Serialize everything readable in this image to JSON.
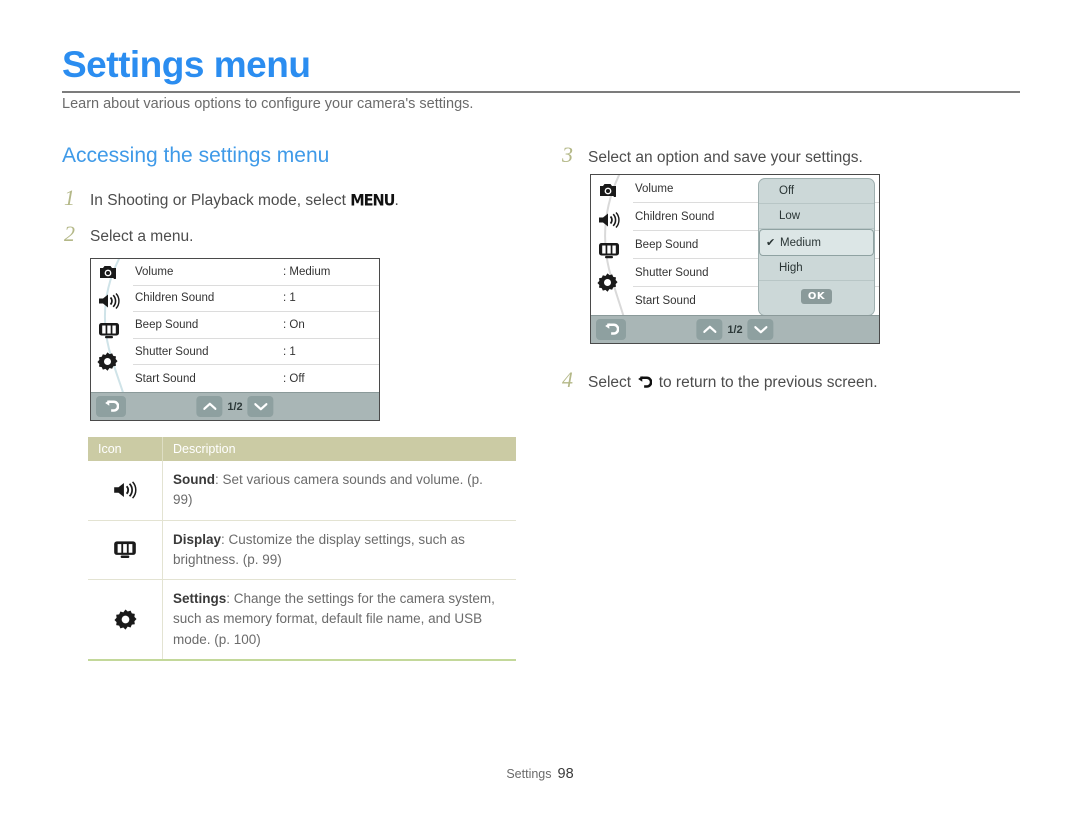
{
  "header": {
    "title": "Settings menu",
    "subtitle": "Learn about various options to configure your camera's settings.",
    "section_heading": "Accessing the settings menu",
    "title_color": "#2b8df0",
    "heading_color": "#3f9ae8"
  },
  "steps": [
    {
      "num": "1",
      "text_before": "In Shooting or Playback mode, select ",
      "glyph": "MENU",
      "text_after": "."
    },
    {
      "num": "2",
      "text_before": "Select a menu.",
      "glyph": "",
      "text_after": ""
    },
    {
      "num": "3",
      "text_before": "Select an option and save your settings.",
      "glyph": "",
      "text_after": ""
    },
    {
      "num": "4",
      "text_before": "Select ",
      "glyph": "back-arrow-icon",
      "text_after": " to return to the previous screen."
    }
  ],
  "step_number_color": "#b4b888",
  "screen1": {
    "rail_icons": [
      "camera-icon",
      "sound-icon",
      "display-icon",
      "settings-gear-icon"
    ],
    "rows": [
      {
        "label": "Volume",
        "value": ": Medium"
      },
      {
        "label": "Children Sound",
        "value": ": 1"
      },
      {
        "label": "Beep Sound",
        "value": ": On"
      },
      {
        "label": "Shutter Sound",
        "value": ": 1"
      },
      {
        "label": "Start Sound",
        "value": ": Off"
      }
    ],
    "toolbar": {
      "back": "back-arrow-icon",
      "up": "chevron-up-icon",
      "page": "1/2",
      "down": "chevron-down-icon"
    }
  },
  "screen2": {
    "rail_icons": [
      "camera-icon",
      "sound-icon",
      "display-icon",
      "settings-gear-icon"
    ],
    "rows": [
      {
        "label": "Volume"
      },
      {
        "label": "Children Sound"
      },
      {
        "label": "Beep Sound"
      },
      {
        "label": "Shutter Sound"
      },
      {
        "label": "Start Sound"
      }
    ],
    "dropdown": {
      "options": [
        {
          "label": "Off",
          "selected": false
        },
        {
          "label": "Low",
          "selected": false
        },
        {
          "label": "Medium",
          "selected": true
        },
        {
          "label": "High",
          "selected": false
        }
      ],
      "check_glyph": "✔",
      "ok_label": "OK"
    },
    "toolbar": {
      "back": "back-arrow-icon",
      "up": "chevron-up-icon",
      "page": "1/2",
      "down": "chevron-down-icon"
    }
  },
  "table": {
    "headers": {
      "icon": "Icon",
      "description": "Description"
    },
    "header_bg": "#cbcba4",
    "rows": [
      {
        "icon": "sound-icon",
        "title": "Sound",
        "text": ": Set various camera sounds and volume. (p. 99)"
      },
      {
        "icon": "display-icon",
        "title": "Display",
        "text": ": Customize the display settings, such as brightness. (p. 99)"
      },
      {
        "icon": "settings-gear-icon",
        "title": "Settings",
        "text": ": Change the settings for the camera system, such as memory format, default file name, and USB mode. (p. 100)"
      }
    ]
  },
  "footer": {
    "label": "Settings",
    "page": "98"
  }
}
